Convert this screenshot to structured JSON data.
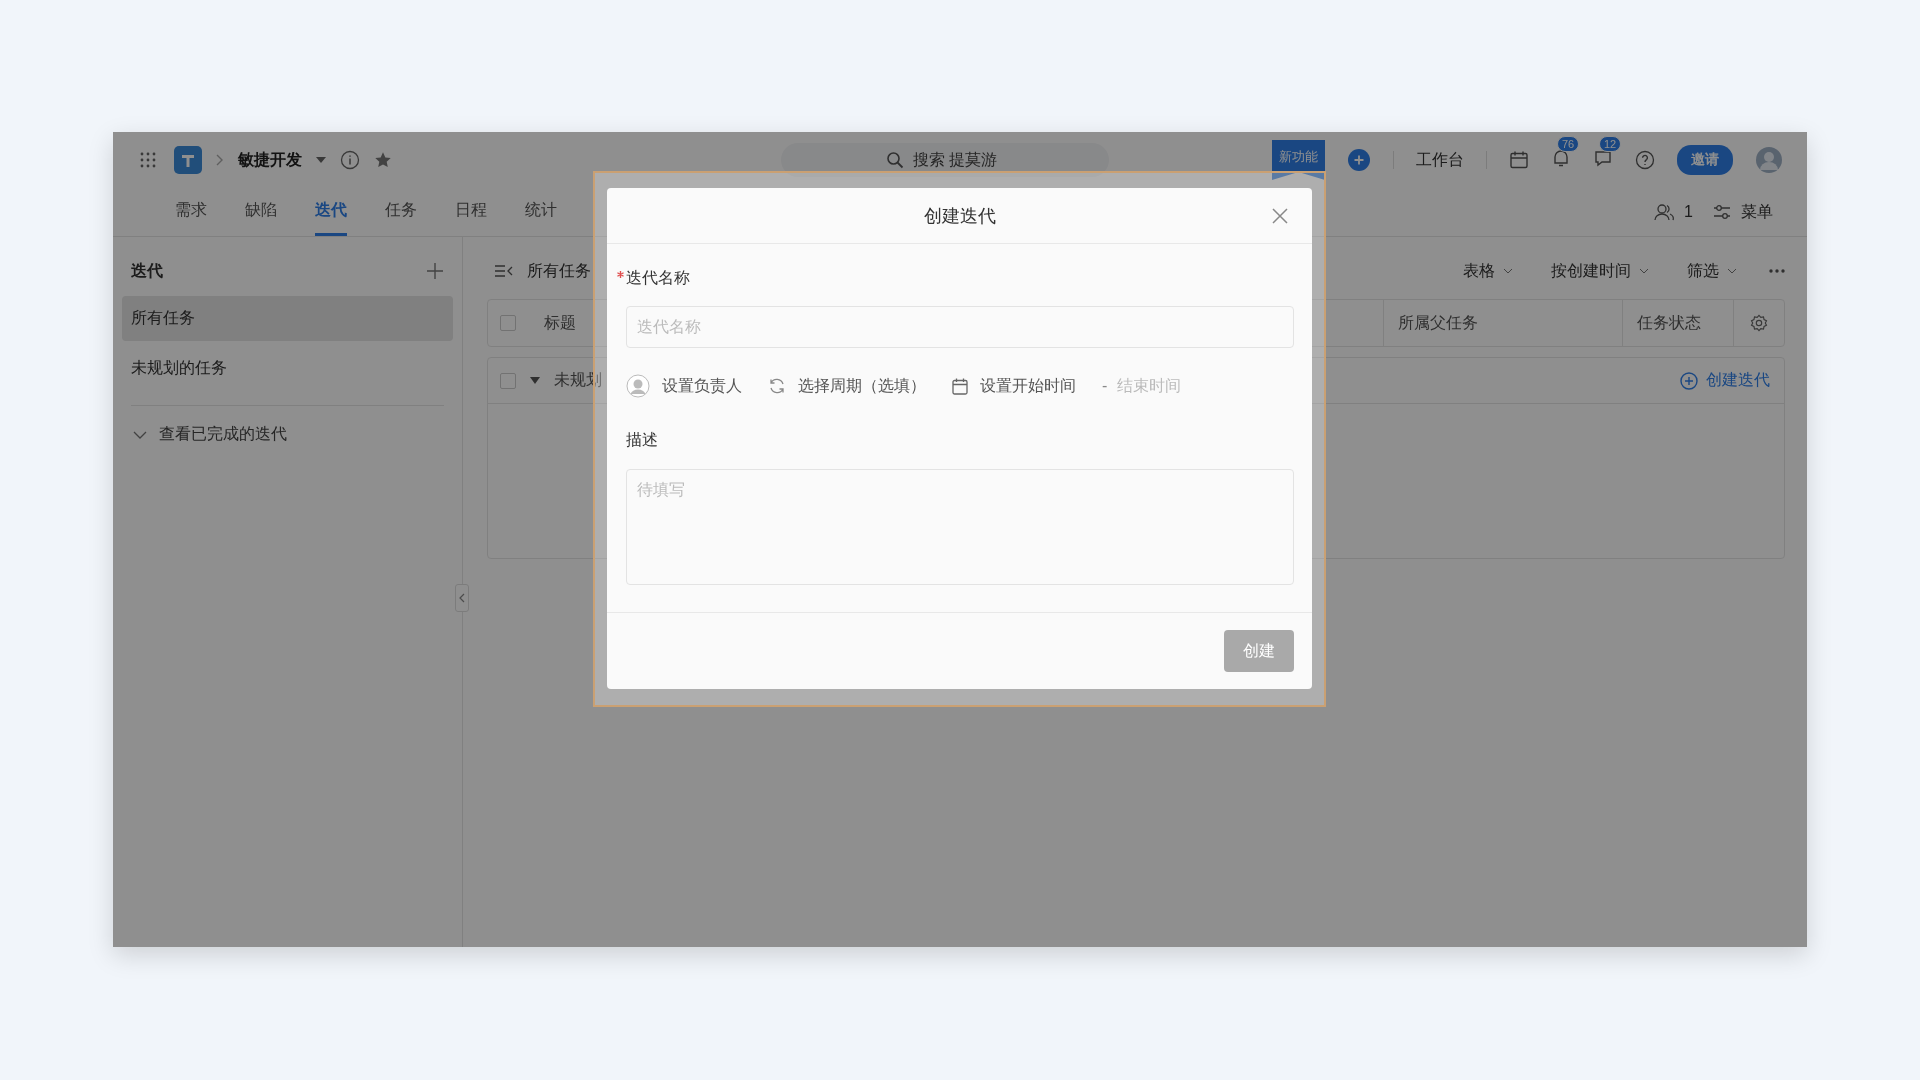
{
  "header": {
    "project": "敏捷开发",
    "search": {
      "placeholder": "搜索 提莫游"
    },
    "new_feature": "新功能",
    "workbench": "工作台",
    "notifications_badge": "76",
    "messages_badge": "12",
    "invite": "邀请"
  },
  "tabs": [
    {
      "label": "需求",
      "selected": false
    },
    {
      "label": "缺陷",
      "selected": false
    },
    {
      "label": "迭代",
      "selected": true
    },
    {
      "label": "任务",
      "selected": false
    },
    {
      "label": "日程",
      "selected": false
    },
    {
      "label": "统计",
      "selected": false
    }
  ],
  "members_count": "1",
  "menu": "菜单",
  "sidebar": {
    "title": "迭代",
    "items": [
      {
        "label": "所有任务",
        "selected": true
      },
      {
        "label": "未规划的任务",
        "selected": false
      }
    ],
    "completed_toggle": "查看已完成的迭代"
  },
  "toolbar": {
    "title": "所有任务",
    "view": "表格",
    "sort": "按创建时间",
    "filter": "筛选"
  },
  "table": {
    "columns": [
      "标题",
      "所属父任务",
      "任务状态"
    ],
    "header_checked": false,
    "group_row": "未规划",
    "group_checked": false,
    "create_link": "创建迭代"
  },
  "dialog": {
    "title": "创建迭代",
    "name_label": "迭代名称",
    "name_required": true,
    "name_placeholder": "迭代名称",
    "assignee": "设置负责人",
    "cycle": "选择周期（选填）",
    "start_time": "设置开始时间",
    "range_separator": "-",
    "end_time_placeholder": "结束时间",
    "description_label": "描述",
    "description_placeholder": "待填写",
    "submit": {
      "label": "创建",
      "disabled": true
    }
  }
}
